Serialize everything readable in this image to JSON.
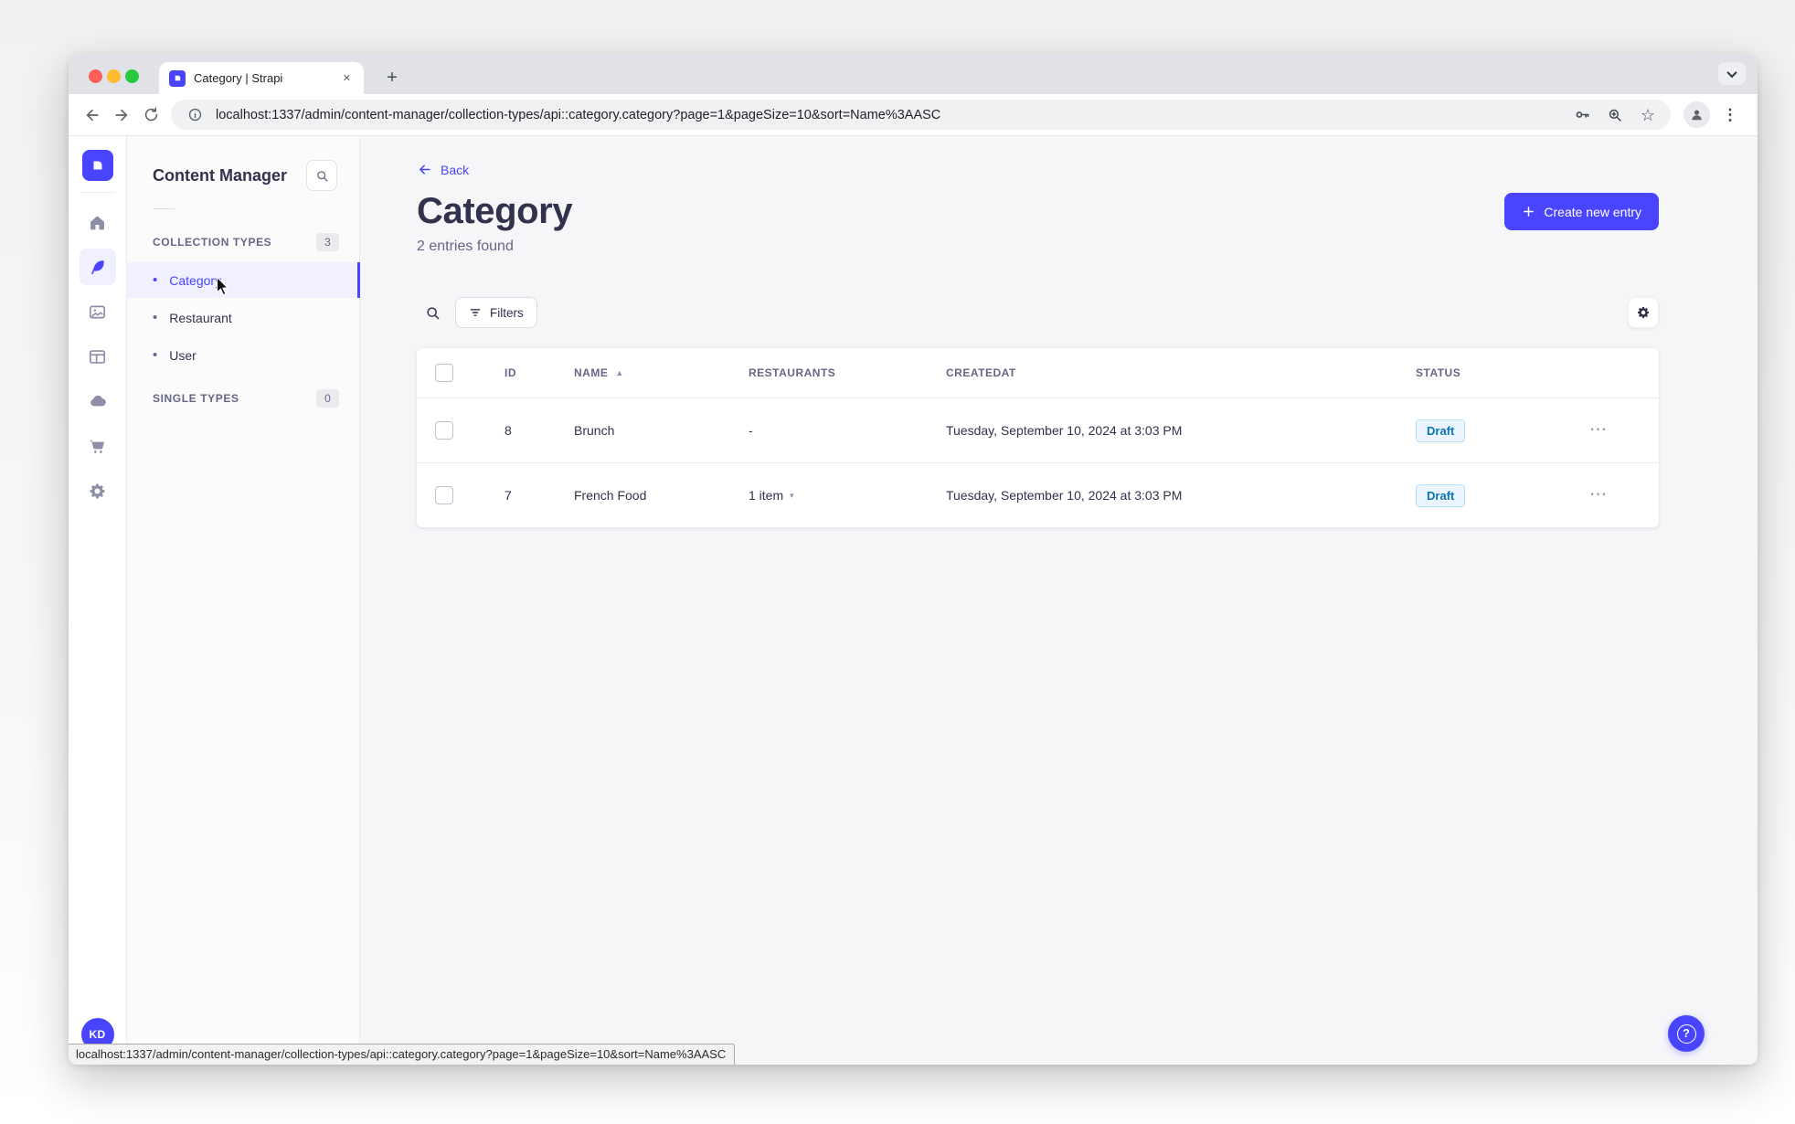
{
  "colors": {
    "primary": "#4945FF",
    "primary_light_bg": "#F0F0FF",
    "draft_bg": "#EAF5FF",
    "draft_border": "#B8E1FF",
    "draft_text": "#0C75AF",
    "main_bg": "#F6F6F9"
  },
  "icons": {
    "close": "✕",
    "new_tab": "+",
    "star": "☆",
    "overflow_menu": "⋮",
    "bullet": "•",
    "sort_asc": "▲",
    "caret_down": "▾",
    "more": "⋯",
    "question": "?"
  },
  "browser": {
    "tab_title": "Category | Strapi",
    "url": "localhost:1337/admin/content-manager/collection-types/api::category.category?page=1&pageSize=10&sort=Name%3AASC"
  },
  "statusbar": {
    "url": "localhost:1337/admin/content-manager/collection-types/api::category.category?page=1&pageSize=10&sort=Name%3AASC"
  },
  "sidebar": {
    "avatar_initials": "KD"
  },
  "subnav": {
    "title": "Content Manager",
    "collection_section": {
      "label": "COLLECTION TYPES",
      "count": "3"
    },
    "items": [
      {
        "label": "Category"
      },
      {
        "label": "Restaurant"
      },
      {
        "label": "User"
      }
    ],
    "single_section": {
      "label": "SINGLE TYPES",
      "count": "0"
    }
  },
  "header": {
    "back_label": "Back",
    "title": "Category",
    "subtitle": "2 entries found",
    "create_label": "Create new entry"
  },
  "filters": {
    "label": "Filters"
  },
  "table": {
    "columns": [
      "ID",
      "NAME",
      "RESTAURANTS",
      "CREATEDAT",
      "STATUS"
    ],
    "rows": [
      {
        "id": "8",
        "name": "Brunch",
        "restaurants": "-",
        "created_at": "Tuesday, September 10, 2024 at 3:03 PM",
        "status": "Draft"
      },
      {
        "id": "7",
        "name": "French Food",
        "restaurants": "1 item",
        "created_at": "Tuesday, September 10, 2024 at 3:03 PM",
        "status": "Draft"
      }
    ]
  }
}
